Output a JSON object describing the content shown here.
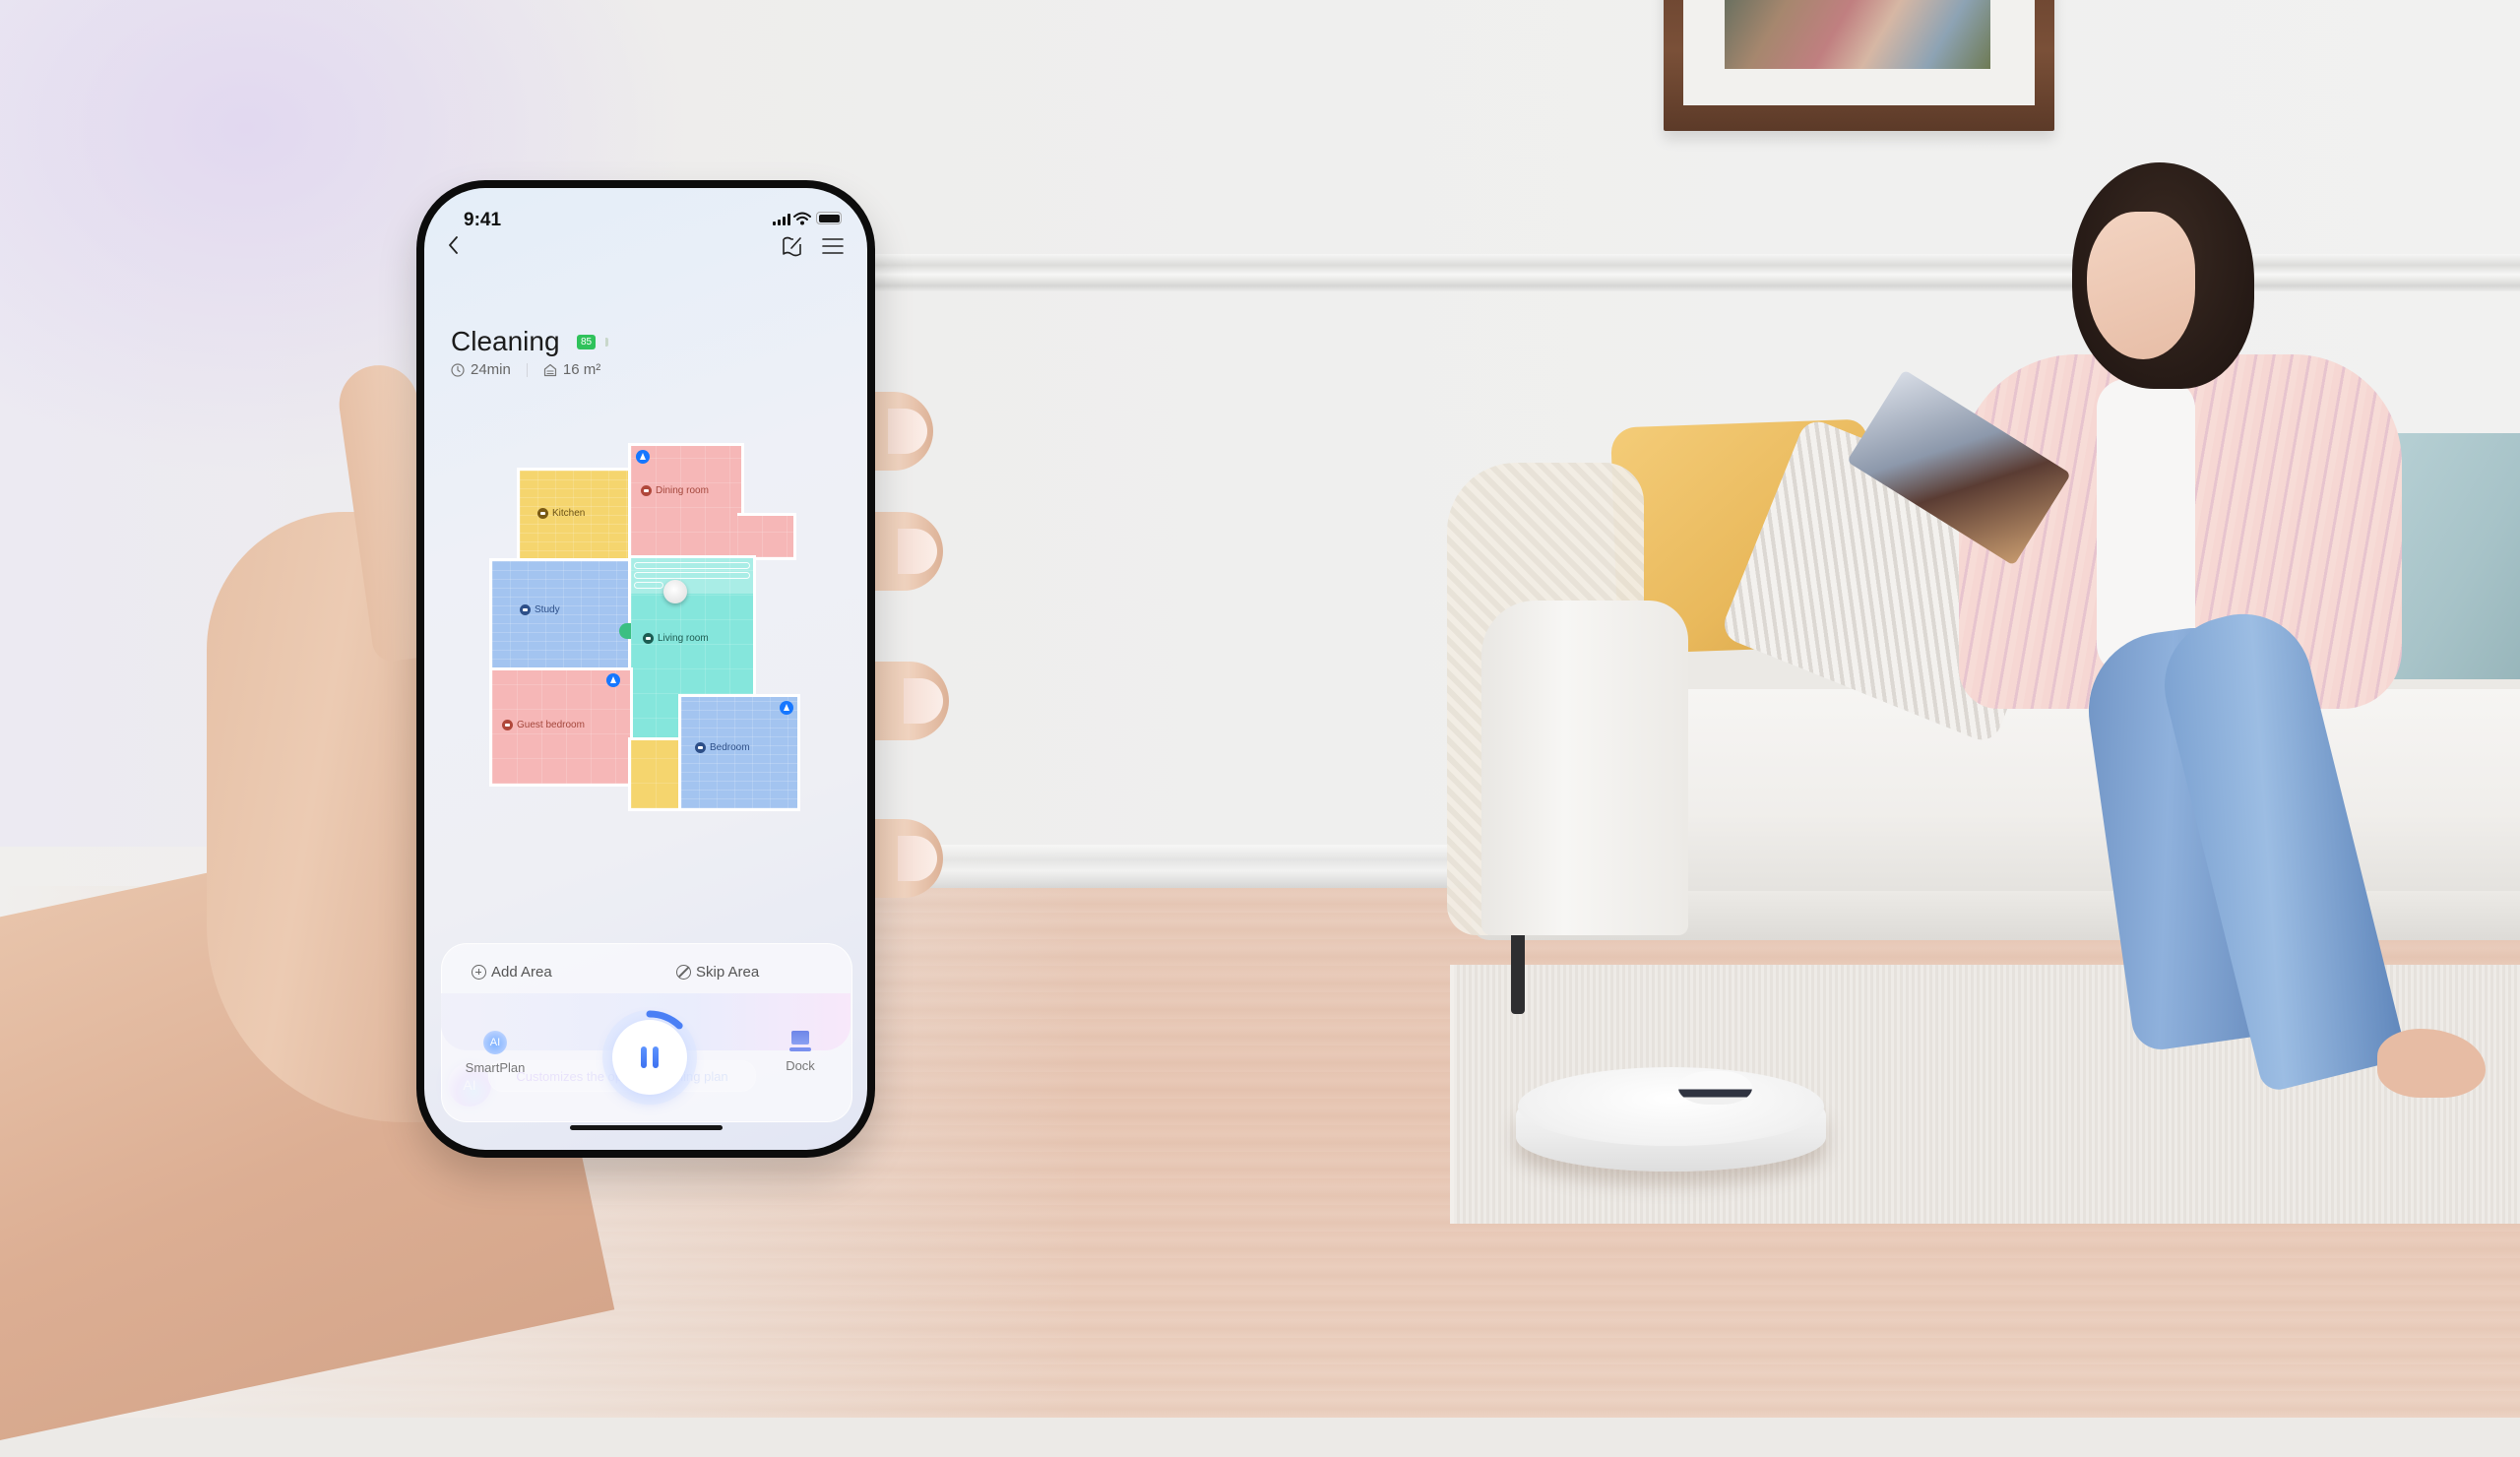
{
  "phone": {
    "status_bar": {
      "time": "9:41",
      "icons": [
        "signal-icon",
        "wifi-icon",
        "battery-icon"
      ]
    },
    "header": {
      "back_icon": "chevron-left-icon",
      "map_icon": "map-edit-icon",
      "menu_icon": "hamburger-menu-icon"
    },
    "title": "Cleaning",
    "battery_level": "85",
    "meta": {
      "duration": "24min",
      "area_value": "16",
      "area_unit": "m²"
    },
    "map": {
      "rooms": [
        {
          "name": "Kitchen",
          "color": "#f5d56e",
          "icon_color": "#7a5a14",
          "text_color": "#6b5216",
          "has_pin": false
        },
        {
          "name": "Dining room",
          "color": "#f6b7b7",
          "icon_color": "#b0473a",
          "text_color": "#a4473c",
          "has_pin": true
        },
        {
          "name": "Study",
          "color": "#a3c4f0",
          "icon_color": "#2d4f88",
          "text_color": "#2d4f88",
          "has_pin": false
        },
        {
          "name": "Living room",
          "color": "#85e6dc",
          "icon_color": "#1c5c52",
          "text_color": "#1d5a50",
          "has_pin": false
        },
        {
          "name": "Guest bedroom",
          "color": "#f6b7b7",
          "icon_color": "#b0473a",
          "text_color": "#a4473c",
          "has_pin": true
        },
        {
          "name": "Bedroom",
          "color": "#a3c4f0",
          "icon_color": "#2d4f88",
          "text_color": "#2d4f88",
          "has_pin": true
        }
      ],
      "unlabeled_area_color": "#f5d56e",
      "pin_color": "#1677ff"
    },
    "ai_suggestion": {
      "orb_label": "AI",
      "text": "Customizes the optimal cleaning plan"
    },
    "actions": {
      "add_area": "Add Area",
      "skip_area": "Skip Area"
    },
    "nav": {
      "smartplan": "SmartPlan",
      "smartplan_icon_label": "AI",
      "dock": "Dock"
    },
    "pause_button": {
      "state": "paused-icon-shown",
      "progress": 0.12,
      "accent": "#4a7ff5"
    }
  },
  "scene": {
    "description": "Living room with a woman reading on a white sofa and a white robot vacuum on a rug",
    "colors": {
      "wall": "#efefee",
      "floor": "#e9cbb9",
      "sofa": "#f1efec",
      "rug": "#ebe8e4"
    }
  }
}
